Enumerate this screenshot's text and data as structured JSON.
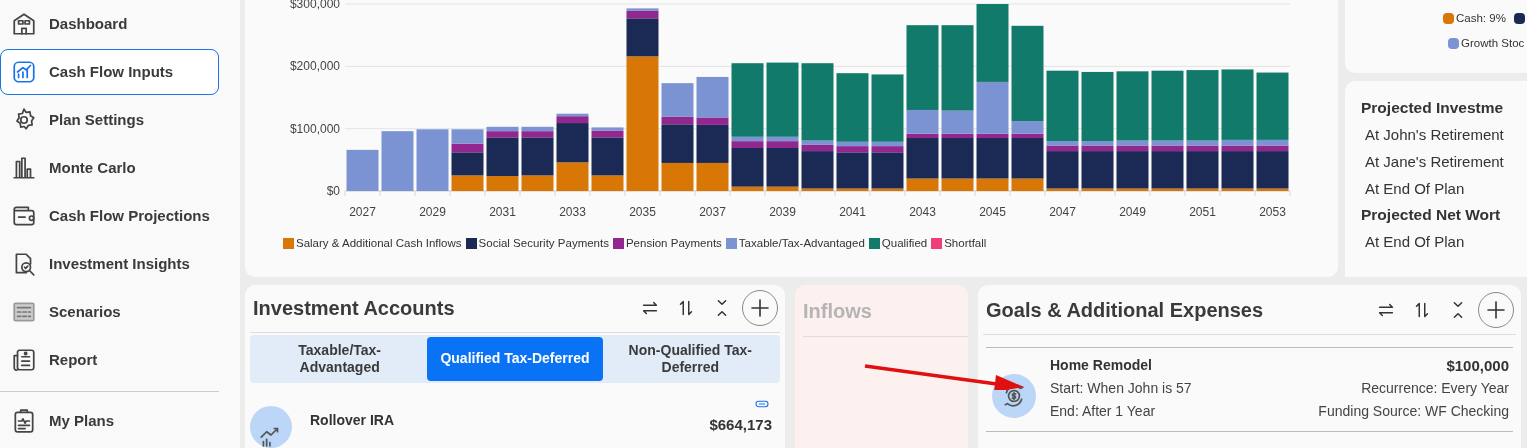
{
  "sidebar": {
    "items": [
      {
        "label": "Dashboard",
        "selected": false
      },
      {
        "label": "Cash Flow Inputs",
        "selected": true
      },
      {
        "label": "Plan Settings",
        "selected": false
      },
      {
        "label": "Monte Carlo",
        "selected": false
      },
      {
        "label": "Cash Flow Projections",
        "selected": false
      },
      {
        "label": "Investment Insights",
        "selected": false
      },
      {
        "label": "Scenarios",
        "selected": false
      },
      {
        "label": "Report",
        "selected": false
      }
    ],
    "footer_items": [
      {
        "label": "My Plans",
        "selected": false
      }
    ]
  },
  "cash_flow_chart": {
    "chart_data": {
      "type": "bar",
      "stacked": true,
      "x": [
        2027,
        2028,
        2029,
        2030,
        2031,
        2032,
        2033,
        2034,
        2035,
        2036,
        2037,
        2038,
        2039,
        2040,
        2041,
        2042,
        2043,
        2044,
        2045,
        2046,
        2047,
        2048,
        2049,
        2050,
        2051,
        2052,
        2053
      ],
      "xticks": [
        2027,
        2029,
        2031,
        2033,
        2035,
        2037,
        2039,
        2041,
        2043,
        2045,
        2047,
        2049,
        2051,
        2053
      ],
      "xlim": [
        2026.5,
        2053.5
      ],
      "ylim": [
        0,
        300000
      ],
      "grid": true,
      "yticks": [
        {
          "value": 0,
          "label": "$0"
        },
        {
          "value": 100000,
          "label": "$100,000"
        },
        {
          "value": 200000,
          "label": "$200,000"
        },
        {
          "value": 300000,
          "label": "$300,000"
        }
      ],
      "series": [
        {
          "name": "Salary & Additional Cash Inflows",
          "color": "#d97706",
          "values": [
            0,
            0,
            0,
            25000,
            24000,
            25000,
            46000,
            25000,
            216000,
            45000,
            45000,
            7000,
            7000,
            4000,
            4000,
            4000,
            20000,
            20000,
            20000,
            20000,
            4000,
            4000,
            4000,
            4000,
            4000,
            4000,
            4000
          ]
        },
        {
          "name": "Social Security Payments",
          "color": "#1b2a55",
          "values": [
            0,
            0,
            0,
            37000,
            62000,
            61000,
            63000,
            61000,
            61000,
            62000,
            61000,
            62000,
            62000,
            60000,
            58000,
            58000,
            65000,
            65000,
            65000,
            65000,
            60000,
            60000,
            60000,
            60000,
            60000,
            60000,
            60000
          ]
        },
        {
          "name": "Pension Payments",
          "color": "#92278f",
          "values": [
            0,
            0,
            0,
            14000,
            10000,
            10000,
            11000,
            11000,
            12000,
            12000,
            12000,
            11000,
            11000,
            10000,
            10000,
            10000,
            7000,
            7000,
            7000,
            7000,
            9000,
            9000,
            9000,
            9000,
            9000,
            9000,
            9000
          ]
        },
        {
          "name": "Taxable/Tax-Advantaged",
          "color": "#7b93d2",
          "values": [
            66000,
            96000,
            99000,
            23000,
            7000,
            7000,
            4000,
            5000,
            4000,
            54000,
            65000,
            7000,
            7000,
            7000,
            7000,
            7000,
            38000,
            37000,
            83000,
            20000,
            7000,
            7000,
            8000,
            8000,
            8000,
            9000,
            9000
          ]
        },
        {
          "name": "Qualified",
          "color": "#127a6a",
          "values": [
            0,
            0,
            0,
            0,
            0,
            0,
            0,
            0,
            0,
            0,
            0,
            118000,
            119000,
            124000,
            110000,
            108000,
            136000,
            137000,
            125000,
            153000,
            113000,
            111000,
            111000,
            112000,
            113000,
            113000,
            108000
          ]
        },
        {
          "name": "Shortfall",
          "color": "#ef3e7a",
          "values": [
            0,
            0,
            0,
            0,
            0,
            0,
            0,
            0,
            0,
            0,
            0,
            0,
            0,
            0,
            0,
            0,
            0,
            0,
            0,
            0,
            0,
            0,
            0,
            0,
            0,
            0,
            0
          ]
        }
      ]
    }
  },
  "allocation_legend": [
    {
      "label": "Cash: 9%",
      "color": "#d97706"
    },
    {
      "color": "#1b2a55"
    },
    {
      "label": "Growth Stoc",
      "color": "#7b93d2"
    }
  ],
  "projections": [
    {
      "heading": "Projected Investme",
      "rows": [
        "At John's Retirement",
        "At Jane's Retirement",
        "At End Of Plan"
      ]
    },
    {
      "heading": "Projected Net Wort",
      "rows": [
        "At End Of Plan"
      ]
    }
  ],
  "investment_accounts": {
    "title": "Investment Accounts",
    "tabs": [
      {
        "label": "Taxable/Tax-Advantaged",
        "selected": false
      },
      {
        "label": "Qualified Tax-Deferred",
        "selected": true
      },
      {
        "label": "Non-Qualified Tax-Deferred",
        "selected": false
      }
    ],
    "account": {
      "name": "Rollover IRA",
      "amount": "$664,173"
    }
  },
  "inflows": {
    "title": "Inflows"
  },
  "goals": {
    "title": "Goals & Additional Expenses",
    "item": {
      "name": "Home Remodel",
      "start": "Start: When John is 57",
      "end": "End: After 1 Year",
      "amount": "$100,000",
      "recurrence": "Recurrence: Every Year",
      "funding": "Funding Source: WF Checking"
    }
  }
}
